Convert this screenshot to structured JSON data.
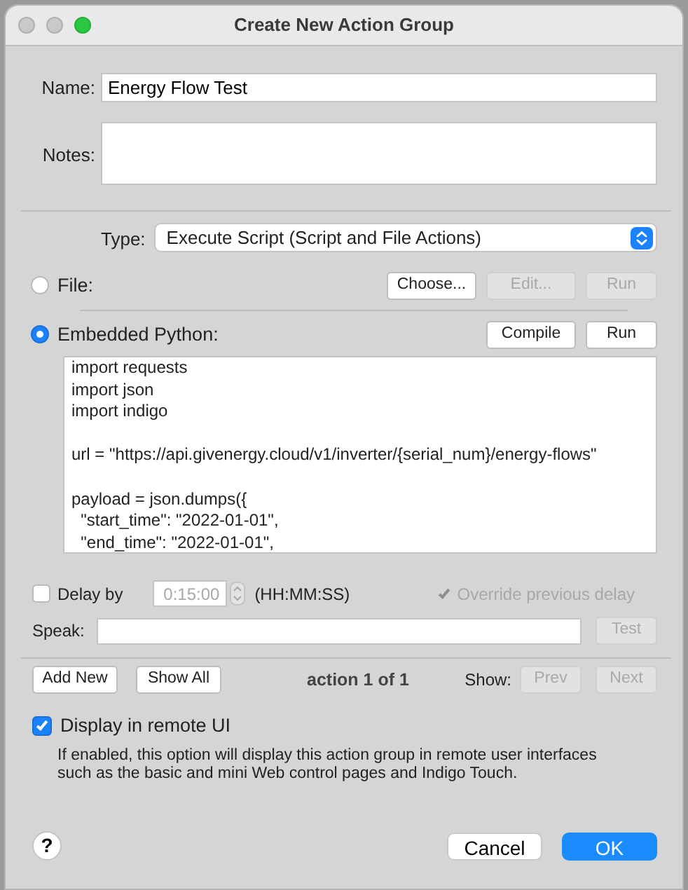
{
  "window": {
    "title": "Create New Action Group"
  },
  "name": {
    "label": "Name:",
    "value": "Energy Flow Test"
  },
  "notes": {
    "label": "Notes:"
  },
  "type": {
    "label": "Type:",
    "value": "Execute Script (Script and File Actions)"
  },
  "file": {
    "label": "File:",
    "selected": false,
    "buttons": [
      {
        "label": "Choose...",
        "disabled": false
      },
      {
        "label": "Edit...",
        "disabled": true
      },
      {
        "label": "Run",
        "disabled": true
      }
    ]
  },
  "embedded": {
    "label": "Embedded Python:",
    "selected": true,
    "buttons": [
      {
        "label": "Compile",
        "disabled": false
      },
      {
        "label": "Run",
        "disabled": false
      }
    ]
  },
  "code": "import requests\nimport json\nimport indigo\n\nurl = \"https://api.givenergy.cloud/v1/inverter/{serial_num}/energy-flows\"\n\npayload = json.dumps({\n  \"start_time\": \"2022-01-01\",\n  \"end_time\": \"2022-01-01\",",
  "delay": {
    "label": "Delay by",
    "checked": false,
    "value": "0:15:00",
    "value_disabled": true,
    "format": "(HH:MM:SS)"
  },
  "override": {
    "label": "Override previous delay",
    "checked": true,
    "disabled": true
  },
  "speak": {
    "label": "Speak:",
    "button": {
      "label": "Test",
      "disabled": true
    }
  },
  "navigation": {
    "buttons": [
      {
        "label": "Add New",
        "disabled": false
      },
      {
        "label": "Show All",
        "disabled": false
      }
    ],
    "counter": "action 1 of 1",
    "show_label": "Show:",
    "pager": [
      {
        "label": "Prev",
        "disabled": true
      },
      {
        "label": "Next",
        "disabled": true
      }
    ]
  },
  "remote_ui": {
    "label": "Display in remote UI",
    "checked": true,
    "description": "If enabled, this option will display this action group in remote user interfaces such as the basic and mini Web control pages and Indigo Touch."
  },
  "footer": {
    "help": "?",
    "cancel": "Cancel",
    "ok": "OK"
  }
}
